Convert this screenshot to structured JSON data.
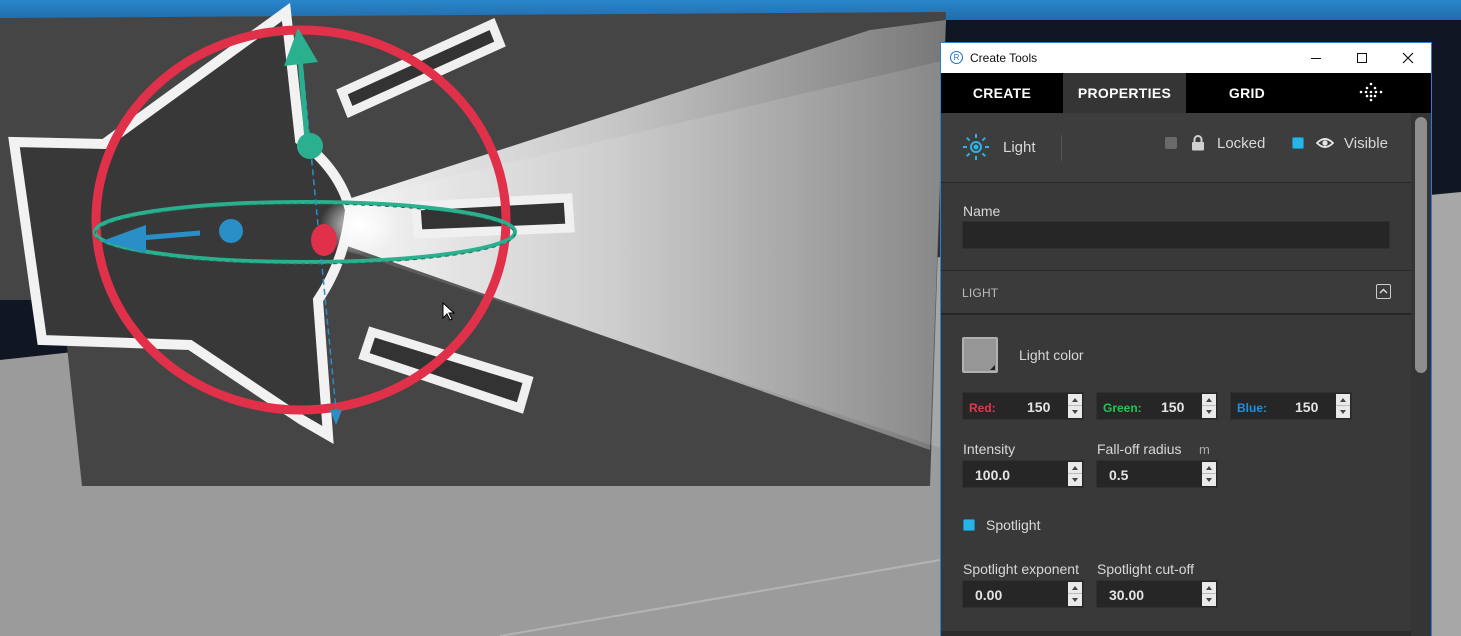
{
  "window": {
    "title": "Create Tools",
    "app_icon_letter": "R"
  },
  "tabs": [
    {
      "label": "CREATE",
      "active": false
    },
    {
      "label": "PROPERTIES",
      "active": true
    },
    {
      "label": "GRID",
      "active": false
    }
  ],
  "object": {
    "type_label": "Light",
    "locked_label": "Locked",
    "locked_checked": false,
    "visible_label": "Visible",
    "visible_checked": true
  },
  "name_section": {
    "label": "Name",
    "value": ""
  },
  "light_section": {
    "header": "LIGHT",
    "color_label": "Light color",
    "color_hex": "#969696",
    "red": {
      "label": "Red:",
      "value": "150",
      "color": "#e8354e"
    },
    "green": {
      "label": "Green:",
      "value": "150",
      "color": "#23c552"
    },
    "blue": {
      "label": "Blue:",
      "value": "150",
      "color": "#1f8fe0"
    },
    "intensity": {
      "label": "Intensity",
      "value": "100.0"
    },
    "falloff": {
      "label": "Fall-off radius",
      "unit": "m",
      "value": "0.5"
    },
    "spotlight": {
      "label": "Spotlight",
      "checked": true
    },
    "spot_exponent": {
      "label": "Spotlight exponent",
      "value": "0.00"
    },
    "spot_cutoff": {
      "label": "Spotlight cut-off",
      "value": "30.00"
    }
  },
  "colors": {
    "accent": "#27b5e8",
    "gizmo_ring": "#e0304a",
    "gizmo_teal": "#2ab08f",
    "gizmo_blue": "#2a8fc6"
  }
}
